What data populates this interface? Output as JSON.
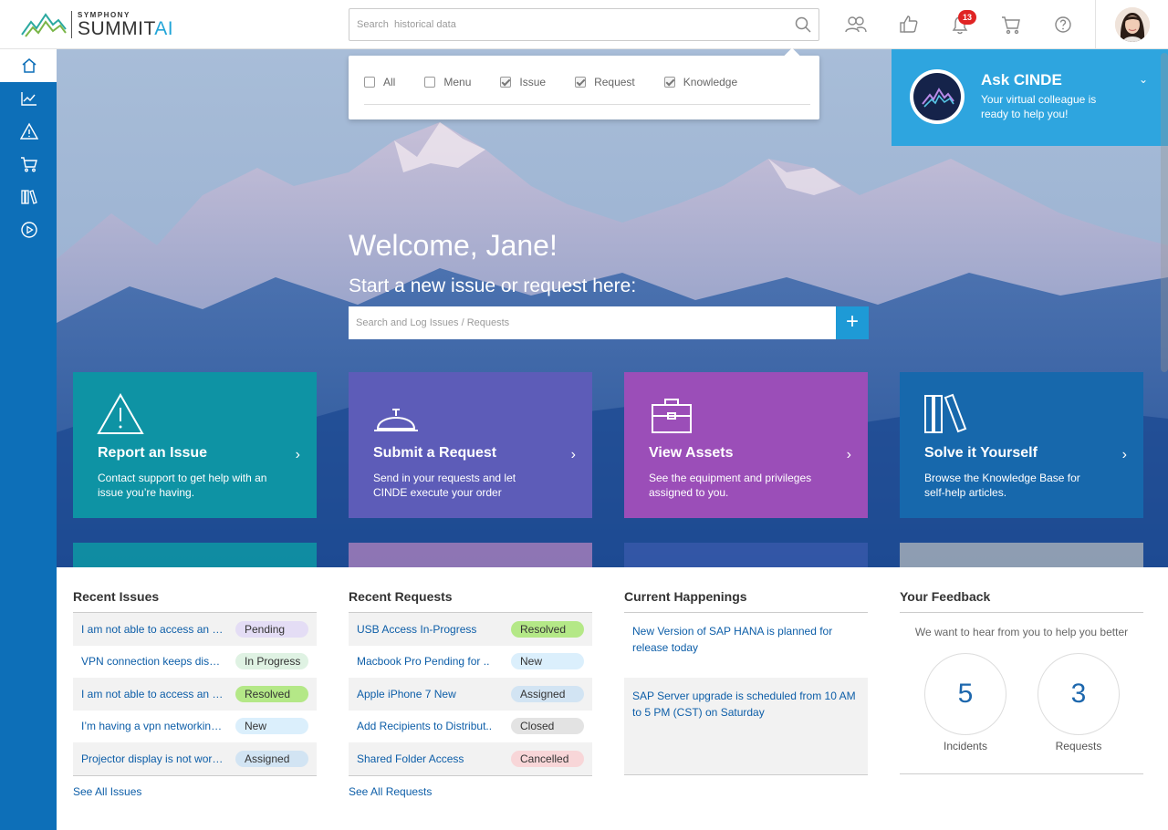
{
  "header": {
    "logo_top": "SYMPHONY",
    "logo_main": "SUMMIT",
    "logo_suffix": "AI",
    "search_placeholder": "Search  historical data",
    "notification_count": "13",
    "icons": [
      "users-icon",
      "thumbs-up-icon",
      "bell-icon",
      "cart-icon",
      "help-icon"
    ]
  },
  "search_filters": [
    {
      "label": "All",
      "checked": false
    },
    {
      "label": "Menu",
      "checked": false
    },
    {
      "label": "Issue",
      "checked": true
    },
    {
      "label": "Request",
      "checked": true
    },
    {
      "label": "Knowledge",
      "checked": true
    }
  ],
  "sidebar": {
    "items": [
      "home-icon",
      "analytics-icon",
      "warning-icon",
      "cart-icon",
      "library-icon",
      "play-icon"
    ]
  },
  "cinde": {
    "title": "Ask CINDE",
    "subtitle": "Your virtual colleague is ready to help you!"
  },
  "hero": {
    "welcome": "Welcome, Jane!",
    "subtitle": "Start a new issue or request here:",
    "log_placeholder": "Search and Log Issues / Requests",
    "plus": "+"
  },
  "tiles": [
    {
      "title": "Report an Issue",
      "desc": "Contact support to get help with an issue you’re having.",
      "color": "#0e93a4",
      "icon": "warning-icon"
    },
    {
      "title": "Submit a Request",
      "desc": "Send in your requests and let CINDE execute your order",
      "color": "#5d5cb8",
      "icon": "service-bell-icon"
    },
    {
      "title": "View Assets",
      "desc": "See the equipment and privileges assigned to you.",
      "color": "#9b4eb8",
      "icon": "briefcase-icon"
    },
    {
      "title": "Solve it Yourself",
      "desc": "Browse the Knowledge Base for self-help articles.",
      "color": "#1768ac",
      "icon": "books-icon"
    }
  ],
  "recent_issues": {
    "title": "Recent Issues",
    "rows": [
      {
        "text": "I am not able to access an Outlook",
        "status": "Pending",
        "color": "#e4ddf5"
      },
      {
        "text": "VPN connection keeps disconnecting",
        "status": "In Progress",
        "color": "#dff2e3"
      },
      {
        "text": "I am not able to access an Outlook",
        "status": "Resolved",
        "color": "#b4e887"
      },
      {
        "text": "I’m having a vpn networking issue",
        "status": "New",
        "color": "#dbeffc"
      },
      {
        "text": "Projector display is not working",
        "status": "Assigned",
        "color": "#d2e4f3"
      }
    ],
    "see_all": "See All Issues"
  },
  "recent_requests": {
    "title": "Recent Requests",
    "rows": [
      {
        "text": "USB Access In-Progress",
        "status": "Resolved",
        "color": "#b4e887"
      },
      {
        "text": "Macbook Pro Pending for ..",
        "status": "New",
        "color": "#dbeffc"
      },
      {
        "text": "Apple iPhone 7 New",
        "status": "Assigned",
        "color": "#d2e4f3"
      },
      {
        "text": "Add Recipients to Distribut..",
        "status": "Closed",
        "color": "#e3e3e3"
      },
      {
        "text": "Shared Folder Access",
        "status": "Cancelled",
        "color": "#f8d6d8"
      }
    ],
    "see_all": "See All Requests"
  },
  "happenings": {
    "title": "Current Happenings",
    "items": [
      "New Version of SAP HANA is planned for release today",
      "SAP Server upgrade is scheduled from 10 AM to 5 PM (CST) on Saturday"
    ]
  },
  "feedback": {
    "title": "Your Feedback",
    "subtitle": "We want to hear from you to help you better",
    "incidents_count": "5",
    "incidents_label": "Incidents",
    "requests_count": "3",
    "requests_label": "Requests"
  }
}
